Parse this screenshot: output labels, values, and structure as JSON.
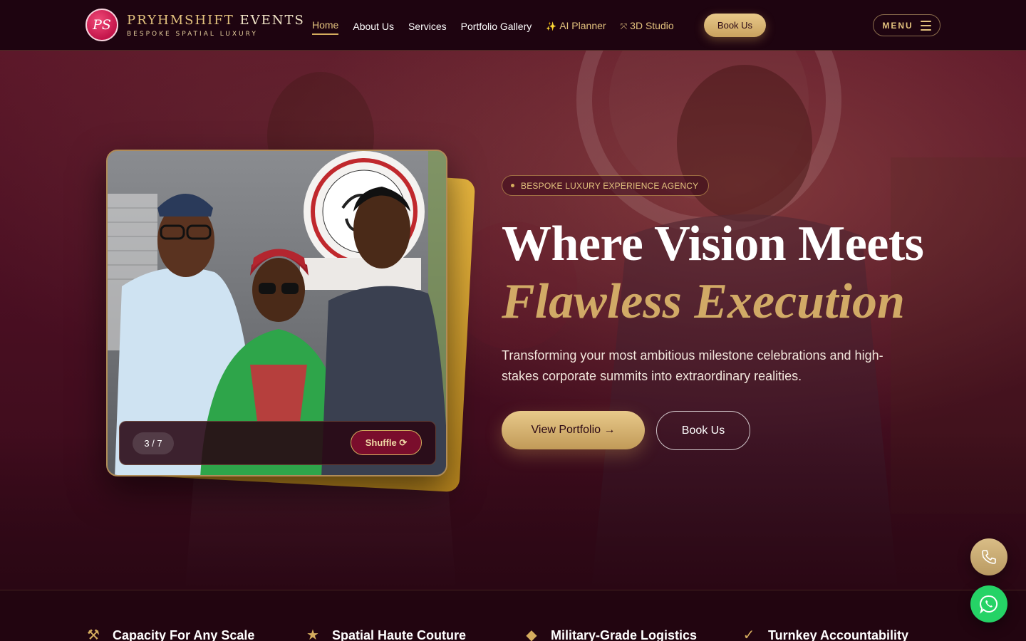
{
  "brand": {
    "mark": "PS",
    "title_primary": "PRYHMSHIFT",
    "title_secondary": "EVENTS",
    "tagline": "BESPOKE SPATIAL LUXURY"
  },
  "nav": {
    "links": [
      {
        "label": "Home",
        "active": true
      },
      {
        "label": "About Us"
      },
      {
        "label": "Services"
      },
      {
        "label": "Portfolio Gallery"
      },
      {
        "label": "AI Planner",
        "icon": "sparkles-icon"
      },
      {
        "label": "3D Studio",
        "icon": "move-arrows-icon"
      }
    ],
    "book_label": "Book Us",
    "menu_label": "MENU"
  },
  "hero": {
    "badge": "BESPOKE LUXURY EXPERIENCE AGENCY",
    "headline_line1": "Where Vision Meets",
    "headline_line2": "Flawless Execution",
    "subcopy": "Transforming your most ambitious milestone celebrations and high-stakes corporate summits into extraordinary realities.",
    "primary_cta": "View Portfolio →",
    "secondary_cta": "Book Us",
    "gallery": {
      "counter": "3 / 7",
      "shuffle_label": "Shuffle ⟳"
    }
  },
  "features": [
    {
      "icon": "hammer-icon",
      "label": "Capacity For Any Scale"
    },
    {
      "icon": "star-icon",
      "label": "Spatial Haute Couture"
    },
    {
      "icon": "diamond-icon",
      "label": "Military-Grade Logistics"
    },
    {
      "icon": "check-icon",
      "label": "Turnkey Accountability"
    }
  ],
  "colors": {
    "accent_gold": "#d5ad5e",
    "background": "#2a0714",
    "brand_pink": "#d81b5a",
    "whatsapp_green": "#25d366"
  }
}
